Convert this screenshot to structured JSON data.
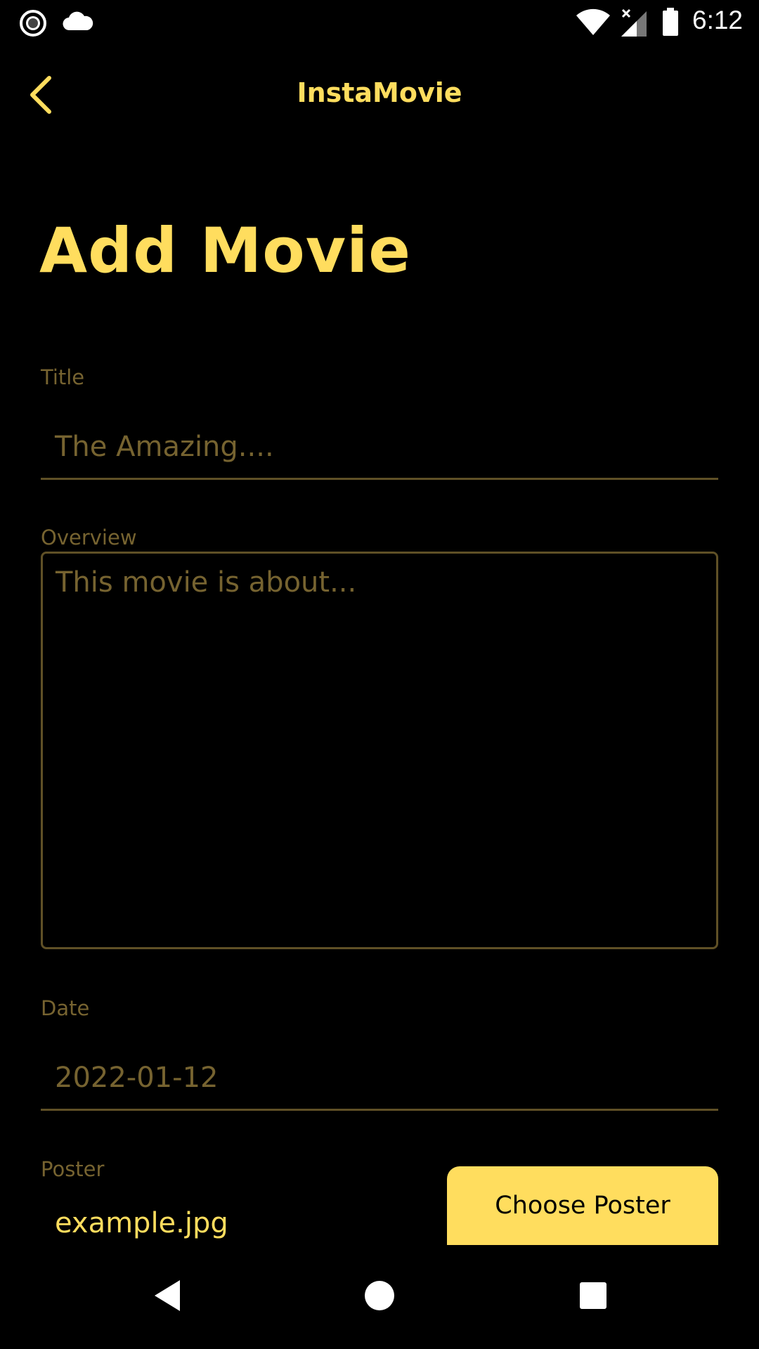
{
  "status_bar": {
    "time": "6:12",
    "icons": [
      "record-icon",
      "cloud-icon",
      "wifi-icon",
      "signal-icon",
      "battery-icon"
    ]
  },
  "app_bar": {
    "back_icon": "chevron-left-icon",
    "title": "InstaMovie"
  },
  "page": {
    "heading": "Add Movie"
  },
  "form": {
    "title": {
      "label": "Title",
      "placeholder": "The Amazing...."
    },
    "overview": {
      "label": "Overview",
      "placeholder": "This movie is about..."
    },
    "date": {
      "label": "Date",
      "value": "2022-01-12"
    },
    "poster": {
      "label": "Poster",
      "filename": "example.jpg",
      "button_label": "Choose Poster"
    }
  },
  "nav_bar": {
    "icons": [
      "nav-back-icon",
      "nav-home-icon",
      "nav-recents-icon"
    ]
  },
  "colors": {
    "background": "#000000",
    "accent": "#FFDD5E",
    "muted": "#766330",
    "border": "#5f5026"
  }
}
